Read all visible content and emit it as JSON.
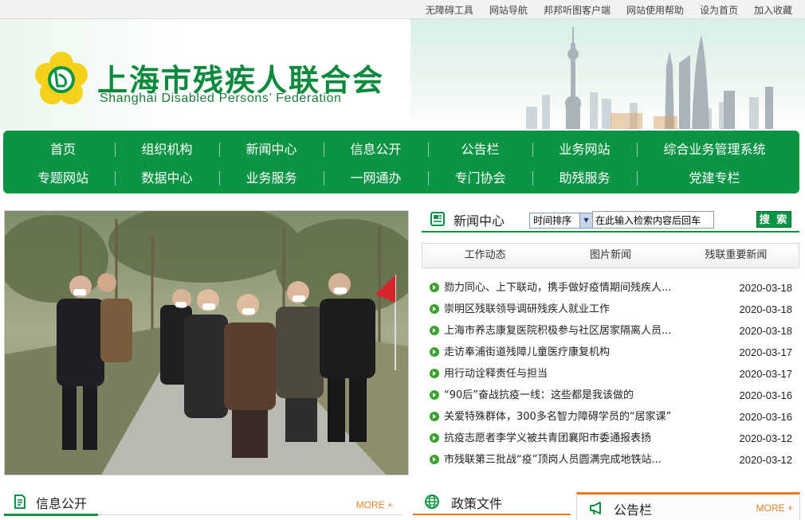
{
  "topbar": {
    "links": [
      "无障碍工具",
      "网站导航",
      "邦邦听图客户端",
      "网站使用帮助",
      "设为首页",
      "加入收藏"
    ]
  },
  "header": {
    "title": "上海市残疾人联合会",
    "subtitle": "Shanghai Disabled Persons’ Federation",
    "logo_icon": "sdpf-emblem-icon",
    "brand_color": "#0b9444"
  },
  "nav": {
    "row1": [
      "首页",
      "组织机构",
      "新闻中心",
      "信息公开",
      "公告栏",
      "业务网站",
      "综合业务管理系统"
    ],
    "row2": [
      "专题网站",
      "数据中心",
      "业务服务",
      "一网通办",
      "专门协会",
      "助残服务",
      "党建专栏"
    ]
  },
  "news": {
    "title": "新闻中心",
    "sort_selected": "时间排序",
    "search_placeholder": "在此输入检索内容后回车",
    "search_button": "搜 索",
    "tabs": [
      "工作动态",
      "图片新闻",
      "残联重要新闻"
    ],
    "items": [
      {
        "title": "勠力同心、上下联动，携手做好疫情期间残疾人...",
        "date": "2020-03-18"
      },
      {
        "title": "崇明区残联领导调研残疾人就业工作",
        "date": "2020-03-18"
      },
      {
        "title": "上海市养志康复医院积极参与社区居家隔离人员...",
        "date": "2020-03-18"
      },
      {
        "title": "走访奉浦街道残障儿童医疗康复机构",
        "date": "2020-03-17"
      },
      {
        "title": "用行动诠释责任与担当",
        "date": "2020-03-17"
      },
      {
        "title": "“90后”奋战抗疫一线：这些都是我该做的",
        "date": "2020-03-16"
      },
      {
        "title": "关爱特殊群体，300多名智力障碍学员的“居家课”",
        "date": "2020-03-16"
      },
      {
        "title": "抗疫志愿者李学义被共青团襄阳市委通报表扬",
        "date": "2020-03-12"
      },
      {
        "title": "市残联第三批战“疫”顶岗人员圆满完成地铁站...",
        "date": "2020-03-12"
      }
    ]
  },
  "sections": {
    "info": {
      "title": "信息公开",
      "more": "MORE +"
    },
    "policy": {
      "title": "政策文件"
    },
    "notice": {
      "title": "公告栏",
      "more": "MORE +"
    }
  },
  "colors": {
    "accent_green": "#0b9444",
    "accent_orange": "#e87c24"
  }
}
